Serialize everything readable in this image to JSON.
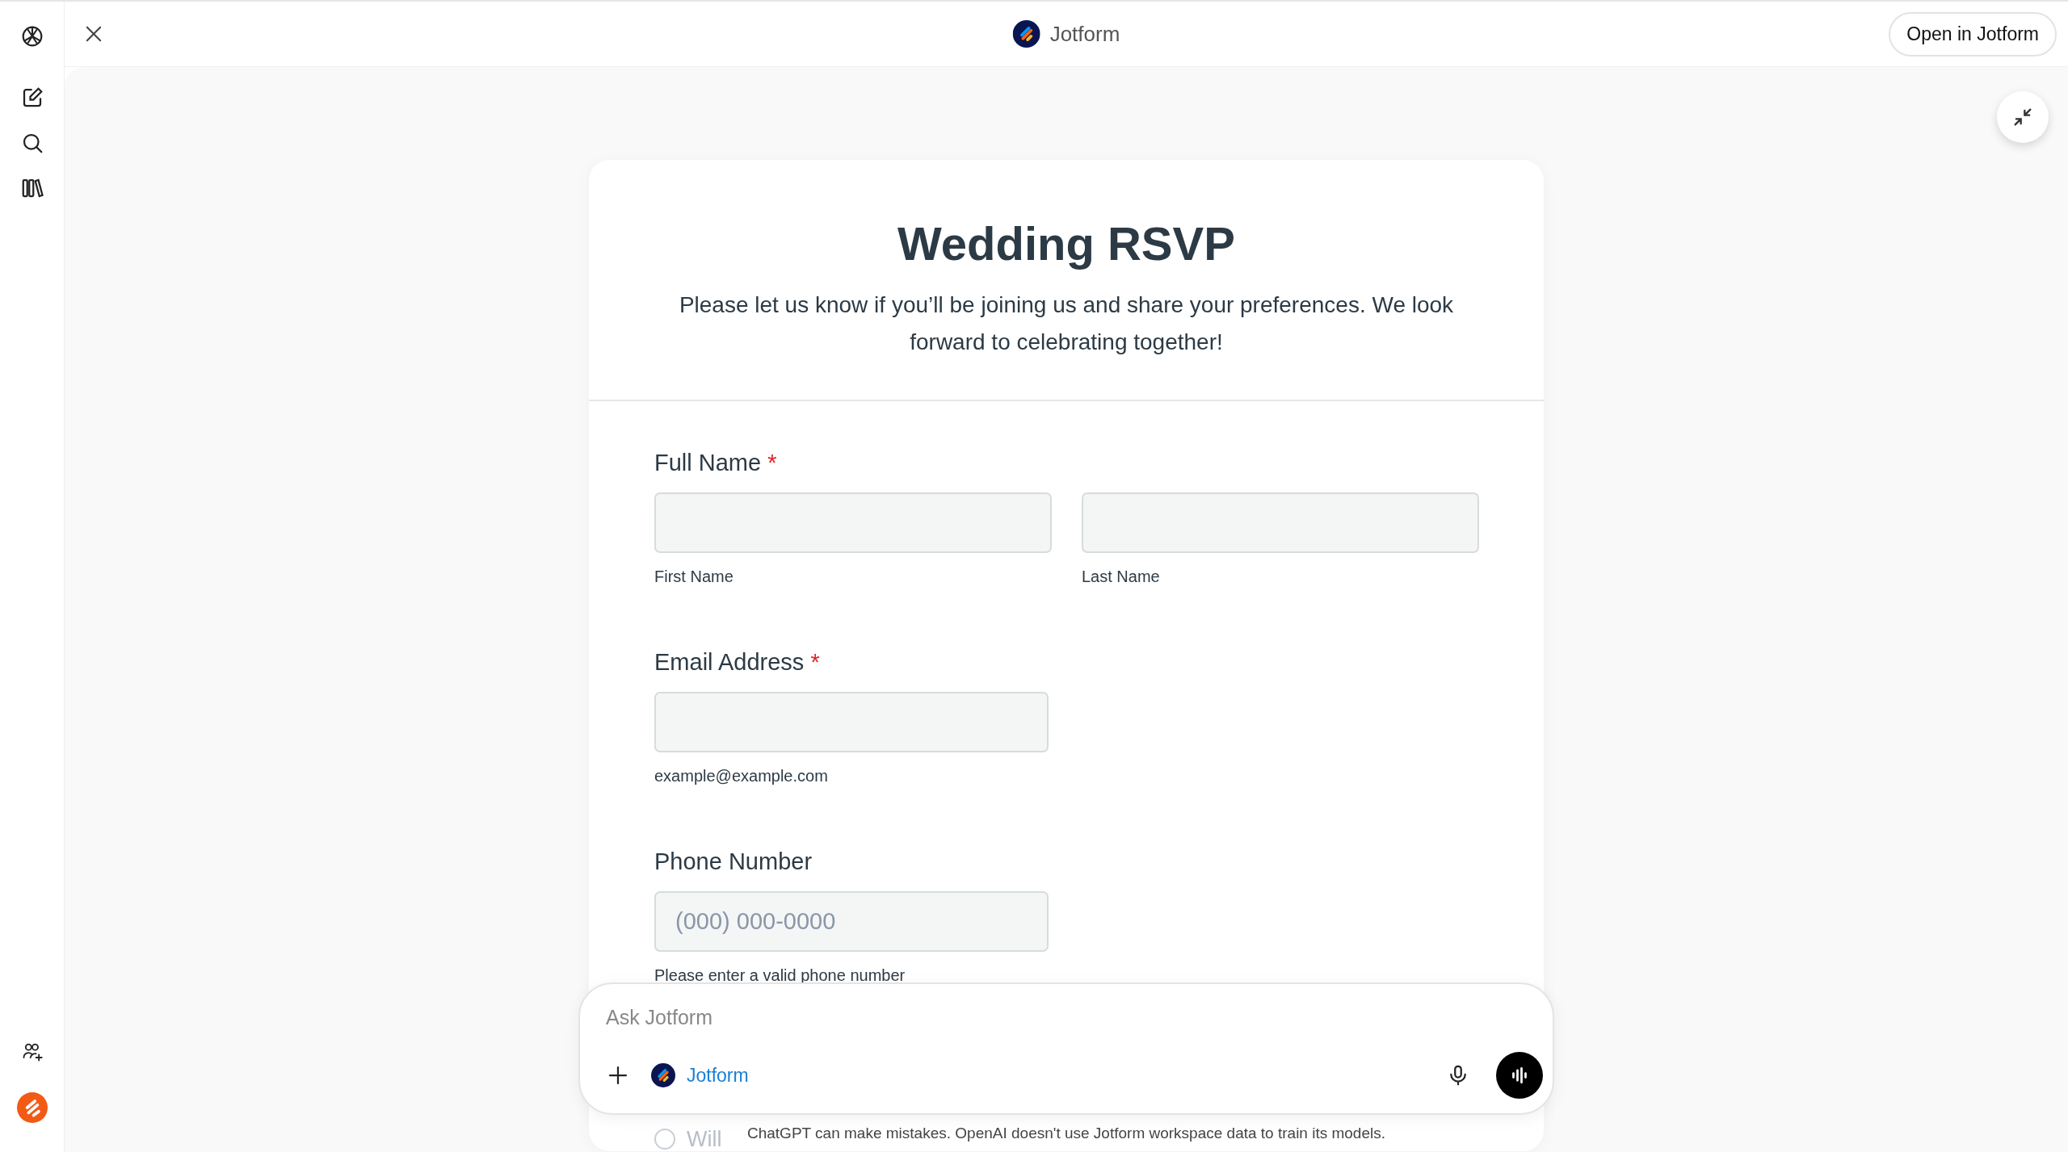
{
  "topbar": {
    "app_name": "Jotform",
    "open_button": "Open in Jotform"
  },
  "form": {
    "title": "Wedding RSVP",
    "description": "Please let us know if you’ll be joining us and share your preferences. We look forward to celebrating together!",
    "required_mark": "*",
    "fields": [
      {
        "kind": "name",
        "label": "Full Name",
        "required": true,
        "sublabels": [
          "First Name",
          "Last Name"
        ]
      },
      {
        "kind": "email",
        "label": "Email Address",
        "required": true,
        "hint": "example@example.com"
      },
      {
        "kind": "phone",
        "label": "Phone Number",
        "required": false,
        "placeholder": "(000) 000-0000",
        "hint": "Please enter a valid phone number"
      },
      {
        "kind": "radio",
        "options": [
          {
            "label": "Will",
            "selected": false
          }
        ]
      }
    ]
  },
  "composer": {
    "placeholder": "Ask Jotform",
    "tool": "Jotform"
  },
  "disclaimer": "ChatGPT can make mistakes. OpenAI doesn't use Jotform workspace data to train its models."
}
